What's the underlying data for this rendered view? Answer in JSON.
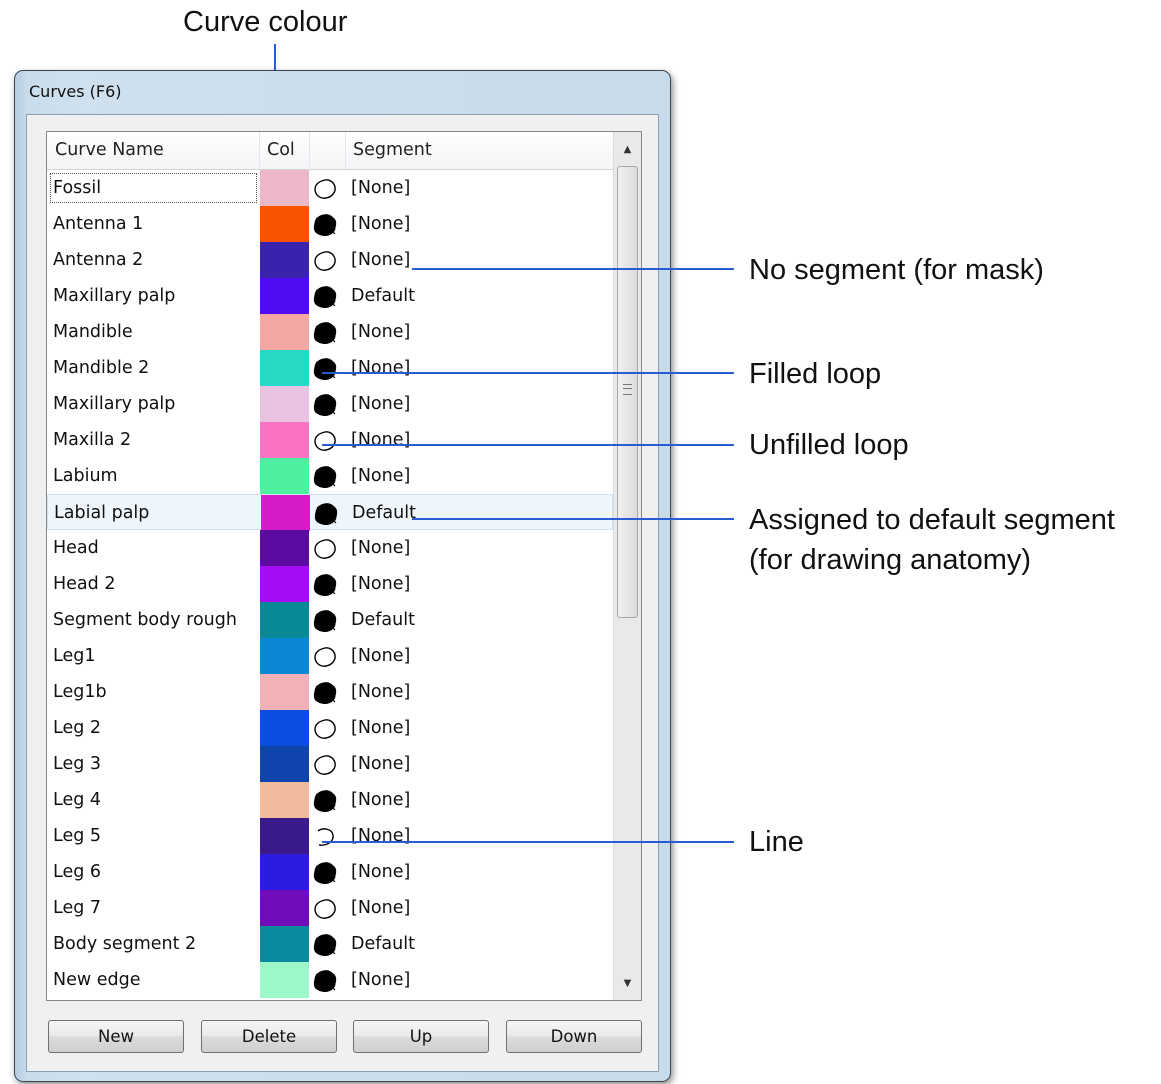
{
  "annotations": {
    "top_label": "Curve colour",
    "right_labels": [
      "No segment (for mask)",
      "Filled loop",
      "Unfilled loop",
      "Assigned to default segment",
      "(for drawing anatomy)",
      "Line"
    ]
  },
  "window": {
    "title": "Curves (F6)"
  },
  "table": {
    "columns": [
      "Curve Name",
      "Col",
      "Segment"
    ],
    "rows": [
      {
        "name": "Fossil",
        "color": "#ecb8c8",
        "shape": "unfilled-loop",
        "segment": "[None]"
      },
      {
        "name": "Antenna 1",
        "color": "#fa5300",
        "shape": "filled-loop",
        "segment": "[None]"
      },
      {
        "name": "Antenna 2",
        "color": "#3b22ac",
        "shape": "unfilled-loop",
        "segment": "[None]"
      },
      {
        "name": "Maxillary palp",
        "color": "#500cf4",
        "shape": "filled-loop",
        "segment": "Default"
      },
      {
        "name": "Mandible",
        "color": "#f4a6a2",
        "shape": "filled-loop",
        "segment": "[None]"
      },
      {
        "name": "Mandible 2",
        "color": "#26d9c4",
        "shape": "filled-loop",
        "segment": "[None]"
      },
      {
        "name": "Maxillary palp",
        "color": "#e8c4e2",
        "shape": "filled-loop",
        "segment": "[None]"
      },
      {
        "name": "Maxilla 2",
        "color": "#fa72c4",
        "shape": "unfilled-loop",
        "segment": "[None]"
      },
      {
        "name": "Labium",
        "color": "#4ef0a0",
        "shape": "filled-loop",
        "segment": "[None]"
      },
      {
        "name": "Labial palp",
        "color": "#d41cc8",
        "shape": "filled-loop",
        "segment": "Default"
      },
      {
        "name": "Head",
        "color": "#5c0ba0",
        "shape": "unfilled-loop",
        "segment": "[None]"
      },
      {
        "name": "Head 2",
        "color": "#a60cf6",
        "shape": "filled-loop",
        "segment": "[None]"
      },
      {
        "name": "Segment body rough",
        "color": "#0a8a96",
        "shape": "filled-loop",
        "segment": "Default"
      },
      {
        "name": "Leg1",
        "color": "#0a88d6",
        "shape": "unfilled-loop",
        "segment": "[None]"
      },
      {
        "name": "Leg1b",
        "color": "#f0b2b6",
        "shape": "filled-loop",
        "segment": "[None]"
      },
      {
        "name": "Leg 2",
        "color": "#0c4ee0",
        "shape": "unfilled-loop",
        "segment": "[None]"
      },
      {
        "name": "Leg 3",
        "color": "#0e44ac",
        "shape": "unfilled-loop",
        "segment": "[None]"
      },
      {
        "name": "Leg 4",
        "color": "#f0ba9c",
        "shape": "filled-loop",
        "segment": "[None]"
      },
      {
        "name": "Leg 5",
        "color": "#3a1a8a",
        "shape": "line",
        "segment": "[None]"
      },
      {
        "name": "Leg 6",
        "color": "#2c1ce2",
        "shape": "filled-loop",
        "segment": "[None]"
      },
      {
        "name": "Leg 7",
        "color": "#700cba",
        "shape": "unfilled-loop",
        "segment": "[None]"
      },
      {
        "name": "Body segment 2",
        "color": "#0a8a9c",
        "shape": "filled-loop",
        "segment": "Default"
      },
      {
        "name": "New edge",
        "color": "#9cf8c8",
        "shape": "filled-loop",
        "segment": "[None]"
      }
    ]
  },
  "buttons": {
    "new_label": "New",
    "delete_label": "Delete",
    "up_label": "Up",
    "down_label": "Down"
  },
  "scrollbar": {
    "up_icon": "▲",
    "down_icon": "▼"
  },
  "colors": {
    "annotation_line": "#2a5bd7"
  }
}
